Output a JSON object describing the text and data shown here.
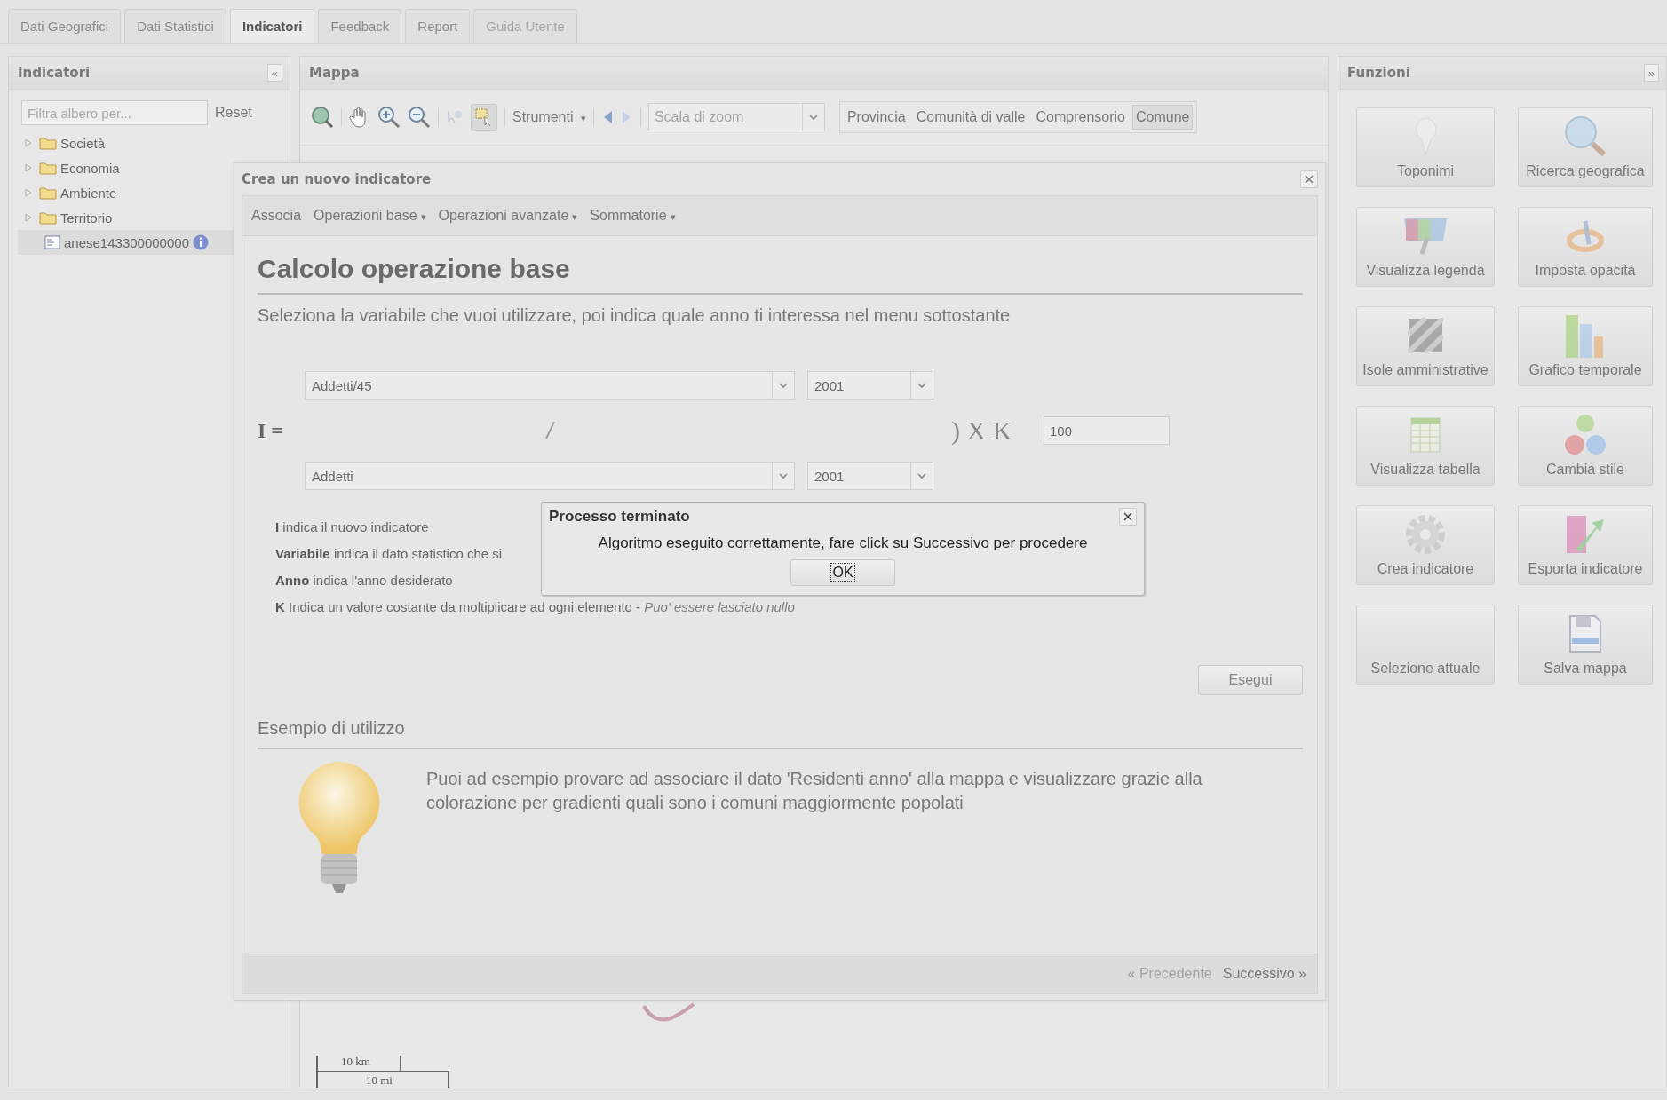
{
  "tabs": [
    {
      "label": "Dati Geografici",
      "selected": false,
      "disabled": false
    },
    {
      "label": "Dati Statistici",
      "selected": false,
      "disabled": false
    },
    {
      "label": "Indicatori",
      "selected": true,
      "disabled": false
    },
    {
      "label": "Feedback",
      "selected": false,
      "disabled": false
    },
    {
      "label": "Report",
      "selected": false,
      "disabled": false
    },
    {
      "label": "Guida Utente",
      "selected": false,
      "disabled": true
    }
  ],
  "left_panel": {
    "title": "Indicatori",
    "collapse": "«",
    "filter": {
      "placeholder": "Filtra albero per..."
    },
    "reset": "Reset",
    "tree": [
      {
        "label": "Società",
        "kind": "folder",
        "selected": false
      },
      {
        "label": "Economia",
        "kind": "folder",
        "selected": false
      },
      {
        "label": "Ambiente",
        "kind": "folder",
        "selected": false
      },
      {
        "label": "Territorio",
        "kind": "folder",
        "selected": false
      },
      {
        "label": "anese143300000000",
        "kind": "layer",
        "selected": true
      }
    ]
  },
  "map_panel": {
    "title": "Mappa",
    "tools_menu": "Strumenti",
    "tools_caret": "▾",
    "zoom_scale": {
      "placeholder": "Scala di zoom"
    },
    "levels": [
      {
        "label": "Provincia",
        "selected": false
      },
      {
        "label": "Comunità di valle",
        "selected": false
      },
      {
        "label": "Comprensorio",
        "selected": false
      },
      {
        "label": "Comune",
        "selected": true
      }
    ],
    "scale_km": "10 km",
    "scale_mi": "10 mi"
  },
  "functions_panel": {
    "title": "Funzioni",
    "expand": "»",
    "buttons": [
      {
        "label": "Toponimi",
        "kind": "pin"
      },
      {
        "label": "Ricerca geografica",
        "kind": "magnifier"
      },
      {
        "label": "Visualizza legenda",
        "kind": "legend"
      },
      {
        "label": "Imposta opacità",
        "kind": "tools"
      },
      {
        "label": "Isole amministrative",
        "kind": "hatch"
      },
      {
        "label": "Grafico temporale",
        "kind": "bars"
      },
      {
        "label": "Visualizza tabella",
        "kind": "table"
      },
      {
        "label": "Cambia stile",
        "kind": "balls"
      },
      {
        "label": "Crea indicatore",
        "kind": "gear"
      },
      {
        "label": "Esporta indicatore",
        "kind": "export"
      },
      {
        "label": "Selezione attuale",
        "kind": "none"
      },
      {
        "label": "Salva mappa",
        "kind": "floppy"
      }
    ]
  },
  "dialog": {
    "title": "Crea un nuovo indicatore",
    "menu": [
      {
        "label": "Associa"
      },
      {
        "label": "Operazioni base",
        "caret": "▾"
      },
      {
        "label": "Operazioni avanzate",
        "caret": "▾"
      },
      {
        "label": "Sommatorie",
        "caret": "▾"
      }
    ],
    "heading": "Calcolo operazione base",
    "instruction": "Seleziona la variabile che vuoi utilizzare, poi indica quale anno ti interessa nel menu sottostante",
    "numerator": {
      "variable": "Addetti/45",
      "year": "2001"
    },
    "formula_lhs": "I =",
    "divider": "/",
    "multiplier": ") X K",
    "k_value": "100",
    "denominator": {
      "variable": "Addetti",
      "year": "2001"
    },
    "legend": [
      "**I** indica il nuovo indicatore",
      "**Variabile** indica il dato statistico che si",
      "**Anno** indica l'anno desiderato",
      "**K** Indica un valore costante da moltiplicare ad ogni elemento - *Puo' essere lasciato nullo*"
    ],
    "run_button": "Esegui",
    "example_title": "Esempio di utilizzo",
    "example_text": "Puoi ad esempio provare ad associare il dato 'Residenti anno' alla mappa e visualizzare grazie alla colorazione per gradienti quali sono i comuni maggiormente popolati",
    "pager": [
      {
        "label": "« Precedente",
        "disabled": true
      },
      {
        "label": "Successivo »",
        "disabled": false
      }
    ]
  },
  "alert": {
    "title": "Processo terminato",
    "message": "Algoritmo eseguito correttamente, fare click su Successivo per procedere",
    "ok": "OK"
  }
}
